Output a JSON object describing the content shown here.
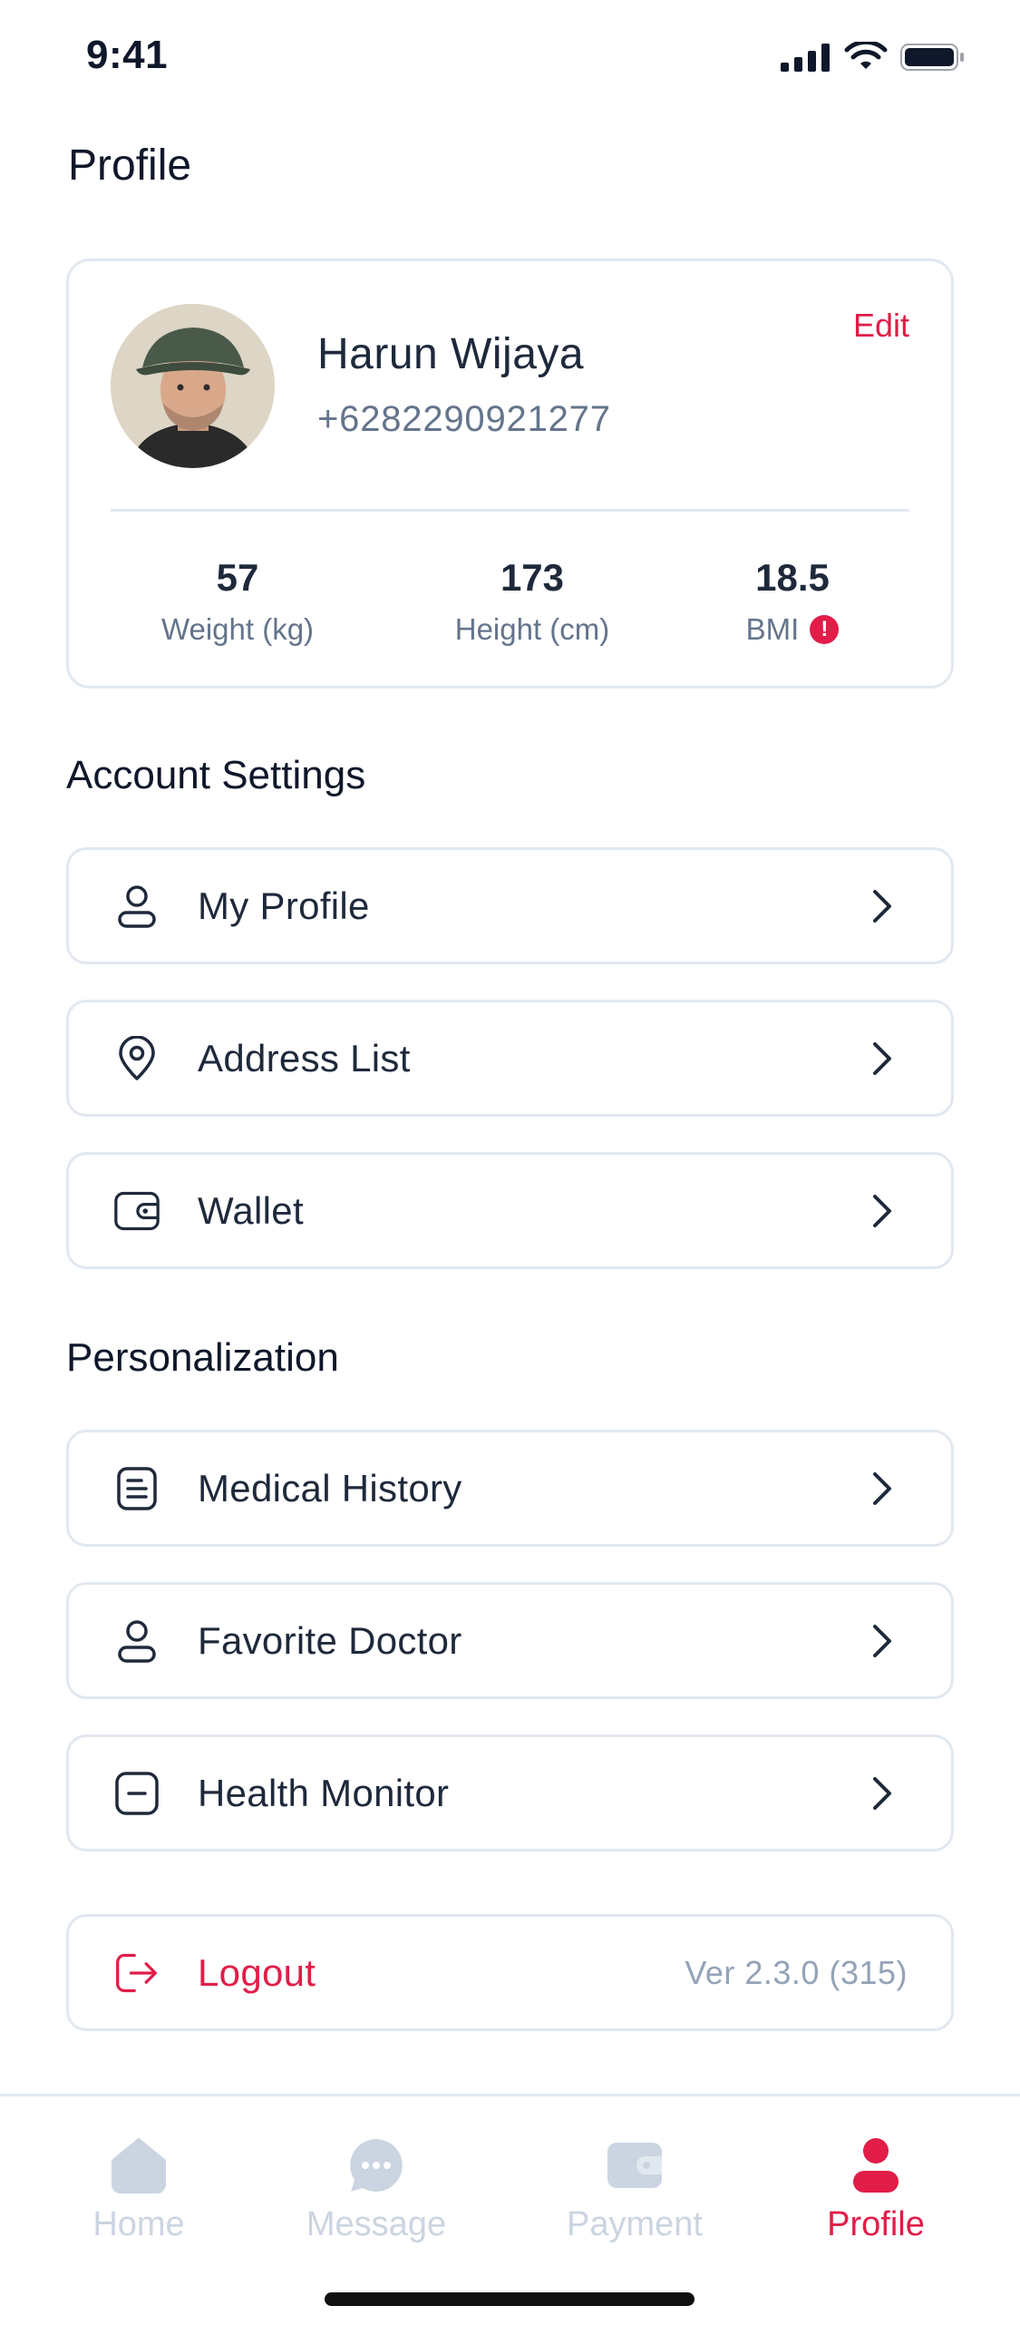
{
  "status_bar": {
    "time": "9:41"
  },
  "page": {
    "title": "Profile"
  },
  "profile": {
    "name": "Harun Wijaya",
    "phone": "+6282290921277",
    "edit_label": "Edit",
    "stats": [
      {
        "value": "57",
        "label": "Weight (kg)"
      },
      {
        "value": "173",
        "label": "Height (cm)"
      },
      {
        "value": "18.5",
        "label": "BMI",
        "alert": "!"
      }
    ]
  },
  "account_settings": {
    "title": "Account Settings",
    "items": [
      {
        "label": "My Profile",
        "icon": "user-icon"
      },
      {
        "label": "Address List",
        "icon": "location-pin-icon"
      },
      {
        "label": "Wallet",
        "icon": "wallet-icon"
      }
    ]
  },
  "personalization": {
    "title": "Personalization",
    "items": [
      {
        "label": "Medical History",
        "icon": "document-list-icon"
      },
      {
        "label": "Favorite Doctor",
        "icon": "user-icon"
      },
      {
        "label": "Health Monitor",
        "icon": "monitor-minus-icon"
      }
    ]
  },
  "logout": {
    "label": "Logout",
    "version": "Ver 2.3.0 (315)",
    "icon": "logout-icon"
  },
  "bottom_nav": {
    "items": [
      {
        "label": "Home",
        "icon": "home-icon",
        "active": false
      },
      {
        "label": "Message",
        "icon": "chat-bubble-icon",
        "active": false
      },
      {
        "label": "Payment",
        "icon": "wallet-icon",
        "active": false
      },
      {
        "label": "Profile",
        "icon": "person-icon",
        "active": true
      }
    ]
  },
  "colors": {
    "accent": "#e11d48",
    "text_primary": "#1e293b",
    "text_secondary": "#64748b",
    "border": "#e2e8f0",
    "nav_inactive": "#cbd5e1"
  }
}
